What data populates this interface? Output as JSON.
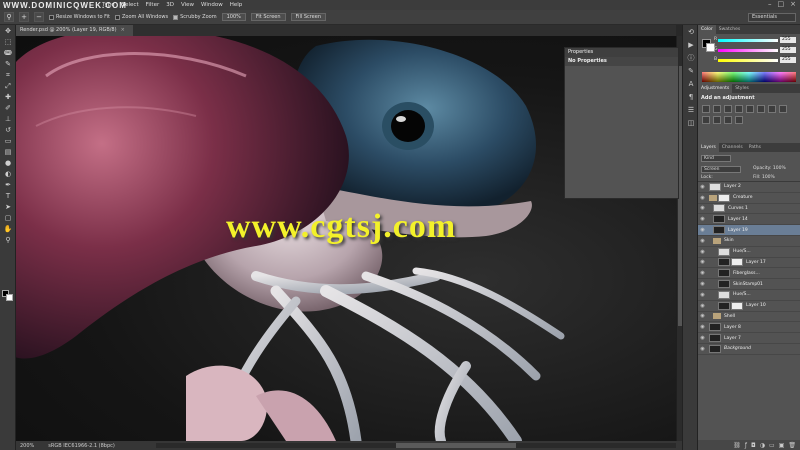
{
  "watermark_top": "WWW.DOMINICQWEK.COM",
  "watermark_center": "www.cgtsj.com",
  "menubar": {
    "app_logo": "Ps",
    "items": [
      "Type",
      "Select",
      "Filter",
      "3D",
      "View",
      "Window",
      "Help"
    ]
  },
  "options_bar": {
    "resize_windows": "Resize Windows to Fit",
    "zoom_all": "Zoom All Windows",
    "scrubby_zoom": "Scrubby Zoom",
    "btn_100": "100%",
    "btn_fit": "Fit Screen",
    "btn_fill": "Fill Screen",
    "workspace": "Essentials"
  },
  "document": {
    "tab_title": "Render.psd @ 200% (Layer 19, RGB/8)",
    "zoom": "200%",
    "doc_info": "sRGB IEC61966-2.1 (8bpc)"
  },
  "properties": {
    "title": "Properties",
    "subtitle": "No Properties"
  },
  "panels": {
    "color_tabs": [
      "Color",
      "Swatches"
    ],
    "color_values": {
      "r": "255",
      "g": "255",
      "b": "255"
    },
    "adjustments_tabs": [
      "Adjustments",
      "Styles"
    ],
    "adjustments_label": "Add an adjustment",
    "layers_tabs": [
      "Layers",
      "Channels",
      "Paths"
    ],
    "kind": "Kind",
    "blend_mode": "Screen",
    "opacity": "Opacity: 100%",
    "fill": "Fill: 100%",
    "lock": "Lock:"
  },
  "layers": [
    {
      "name": "Layer 2"
    },
    {
      "name": "Creature"
    },
    {
      "name": "Curves 1"
    },
    {
      "name": "Layer 14"
    },
    {
      "name": "Layer 19"
    },
    {
      "name": "Skin"
    },
    {
      "name": "Hue/S..."
    },
    {
      "name": "Layer 17"
    },
    {
      "name": "Fiberglass..."
    },
    {
      "name": "SkinStamp01"
    },
    {
      "name": "Hue/S..."
    },
    {
      "name": "Layer 10"
    },
    {
      "name": "Shell"
    },
    {
      "name": "Layer 8"
    },
    {
      "name": "Layer 7"
    },
    {
      "name": "Background"
    }
  ]
}
